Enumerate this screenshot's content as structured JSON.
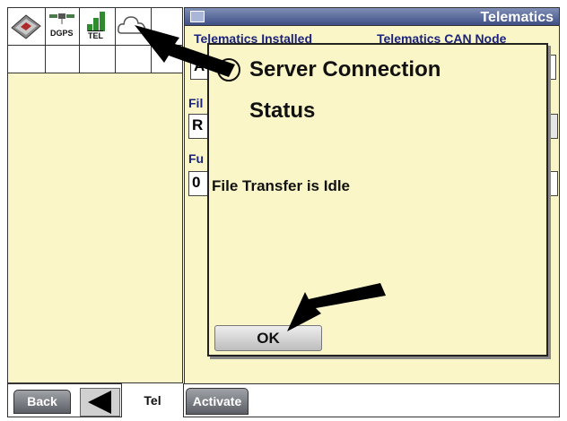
{
  "icon_tray": {
    "dgps_label": "DGPS",
    "tel_label": "TEL"
  },
  "header": {
    "title": "Telematics"
  },
  "fields": {
    "telematics_installed_label": "Telematics Installed",
    "telematics_installed_value": "A",
    "telematics_can_node_label": "Telematics CAN Node",
    "file_label": "Fil",
    "file_value": "R",
    "function_label": "Fu",
    "function_value": "0"
  },
  "dialog": {
    "info_glyph": "i",
    "title_line1": "Server Connection",
    "title_line2": "Status",
    "message": "File Transfer is Idle",
    "ok_label": "OK"
  },
  "bottom_bar": {
    "back_label": "Back",
    "tab_label": "Tel",
    "activate_label": "Activate"
  },
  "colors": {
    "panel_bg": "#fbf6c8",
    "header_bg": "#3f4f86",
    "label_blue": "#1a237e",
    "signal_green": "#2e8b2e"
  },
  "icons": [
    "book-icon",
    "dgps-satellite-icon",
    "signal-strength-icon",
    "cloud-icon",
    "info-icon",
    "dropdown-arrow-icon",
    "left-arrow-icon"
  ]
}
